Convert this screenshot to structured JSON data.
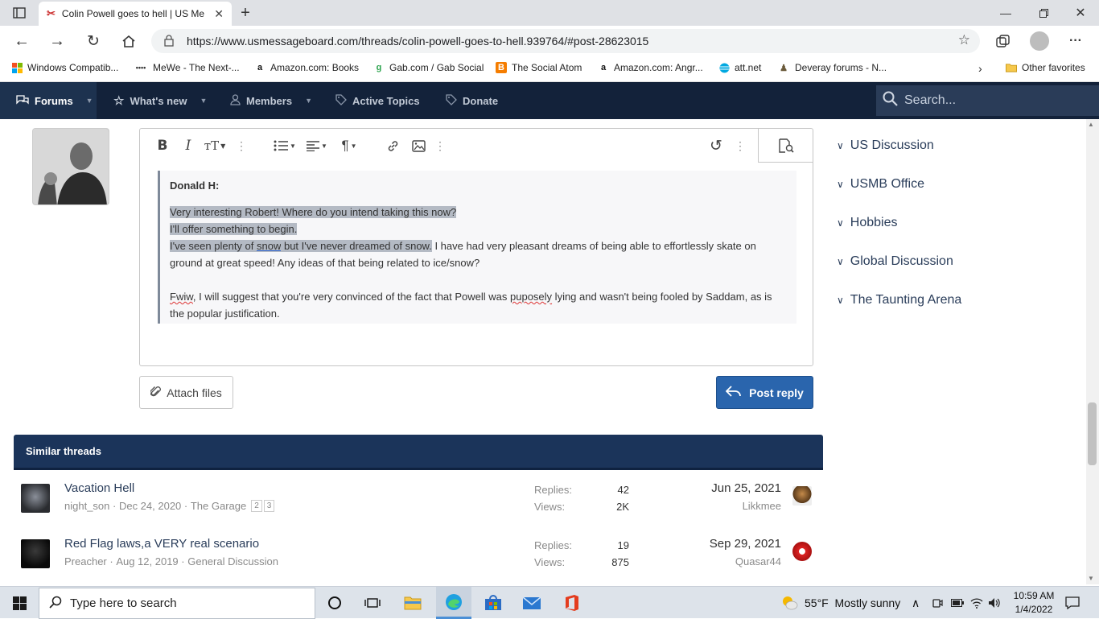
{
  "browser": {
    "tab_title": "Colin Powell goes to hell | US Me",
    "url": "https://www.usmessageboard.com/threads/colin-powell-goes-to-hell.939764/#post-28623015",
    "bookmarks": [
      {
        "label": "Windows Compatib...",
        "icon": "windows-logo-icon"
      },
      {
        "label": "MeWe - The Next-...",
        "icon": "mewe-icon"
      },
      {
        "label": "Amazon.com: Books",
        "icon": "amazon-icon"
      },
      {
        "label": "Gab.com / Gab Social",
        "icon": "gab-icon"
      },
      {
        "label": "The Social Atom",
        "icon": "blogger-icon"
      },
      {
        "label": "Amazon.com: Angr...",
        "icon": "amazon-icon"
      },
      {
        "label": "att.net",
        "icon": "att-icon"
      },
      {
        "label": "Deveray forums - N...",
        "icon": "forum-icon"
      }
    ],
    "other_favorites": "Other favorites"
  },
  "nav": {
    "forums": "Forums",
    "whats_new": "What's new",
    "members": "Members",
    "active_topics": "Active Topics",
    "donate": "Donate",
    "search_placeholder": "Search..."
  },
  "editor": {
    "quote_author": "Donald H:",
    "line1": "Very interesting Robert! Where do you intend taking this now?",
    "line2": "I'll offer something to begin.",
    "line3a": "I've seen plenty of ",
    "line3b": "snow",
    "line3c": " but I've never dreamed of snow.",
    "line3d": " I have had very pleasant dreams of being able to effortlessly skate on ground at great speed! Any ideas of that being related to ice/snow?",
    "para2a": "Fwiw",
    "para2b": ", I will suggest that you're very convinced of the fact that Powell was ",
    "para2c": "puposely",
    "para2d": " lying and wasn't being fooled by Saddam, as is the popular justification."
  },
  "actions": {
    "attach_files": "Attach files",
    "post_reply": "Post reply"
  },
  "sidebar": {
    "categories": [
      "US Discussion",
      "USMB Office",
      "Hobbies",
      "Global Discussion",
      "The Taunting Arena"
    ]
  },
  "similar": {
    "heading": "Similar threads",
    "replies_label": "Replies:",
    "views_label": "Views:",
    "threads": [
      {
        "title": "Vacation Hell",
        "author": "night_son",
        "date": "Dec 24, 2020",
        "forum": "The Garage",
        "pages": [
          "2",
          "3"
        ],
        "replies": "42",
        "views": "2K",
        "last_date": "Jun 25, 2021",
        "last_user": "Likkmee"
      },
      {
        "title": "Red Flag laws,a VERY real scenario",
        "author": "Preacher",
        "date": "Aug 12, 2019",
        "forum": "General Discussion",
        "pages": [],
        "replies": "19",
        "views": "875",
        "last_date": "Sep 29, 2021",
        "last_user": "Quasar44"
      }
    ]
  },
  "taskbar": {
    "search_placeholder": "Type here to search",
    "weather": "55°F  Mostly sunny",
    "time": "10:59 AM",
    "date": "1/4/2022"
  }
}
